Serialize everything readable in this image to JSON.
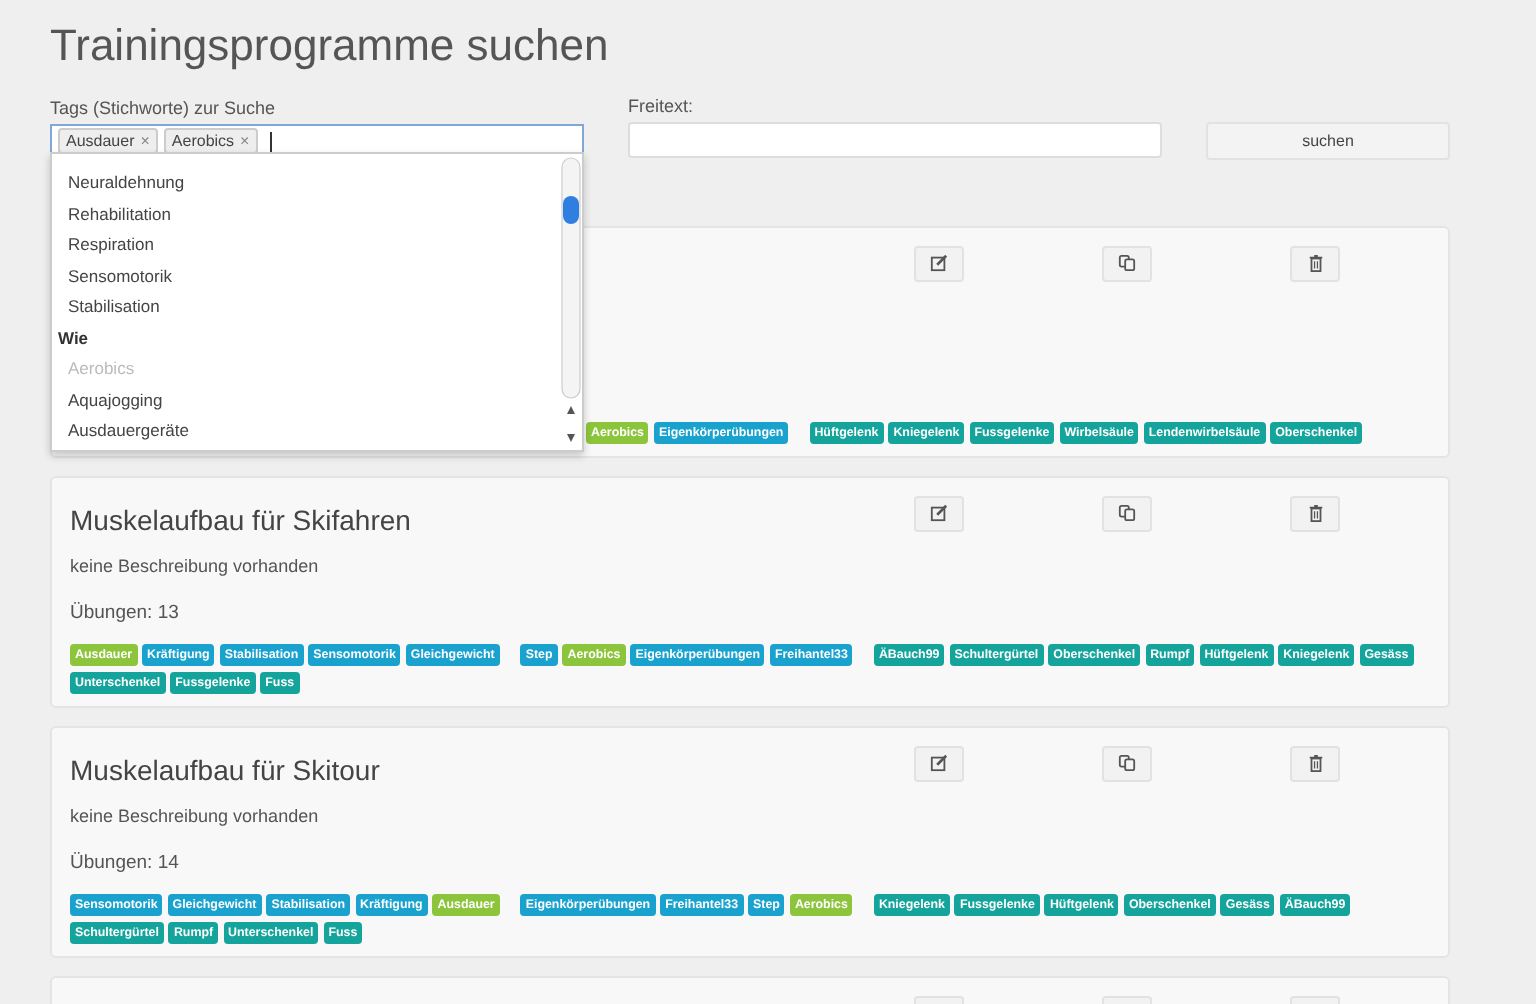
{
  "title": "Trainingsprogramme suchen",
  "search": {
    "tags_label": "Tags (Stichworte) zur Suche",
    "chips": [
      {
        "label": "Ausdauer",
        "remove": "×"
      },
      {
        "label": "Aerobics",
        "remove": "×"
      }
    ],
    "freetext_label": "Freitext:",
    "button": "suchen"
  },
  "dropdown": [
    {
      "kind": "option",
      "label": "Neuraldehnung",
      "disabled": false
    },
    {
      "kind": "option",
      "label": "Rehabilitation",
      "disabled": false
    },
    {
      "kind": "option",
      "label": "Respiration",
      "disabled": false
    },
    {
      "kind": "option",
      "label": "Sensomotorik",
      "disabled": false
    },
    {
      "kind": "option",
      "label": "Stabilisation",
      "disabled": false
    },
    {
      "kind": "group",
      "label": "Wie"
    },
    {
      "kind": "option",
      "label": "Aerobics",
      "disabled": true
    },
    {
      "kind": "option",
      "label": "Aquajogging",
      "disabled": false
    },
    {
      "kind": "option",
      "label": "Ausdauergeräte",
      "disabled": false
    }
  ],
  "cards": [
    {
      "kind": "covered",
      "tag_groups": [
        [
          {
            "label": "Aerobics",
            "color": "#8cc43c"
          },
          {
            "label": "Eigenkörperübungen",
            "color": "#1aa2cf"
          }
        ],
        [
          {
            "label": "Hüftgelenk",
            "color": "#14a49c"
          },
          {
            "label": "Kniegelenk",
            "color": "#14a49c"
          },
          {
            "label": "Fussgelenke",
            "color": "#14a49c"
          },
          {
            "label": "Wirbelsäule",
            "color": "#14a49c"
          },
          {
            "label": "Lendenwirbelsäule",
            "color": "#14a49c"
          },
          {
            "label": "Oberschenkel",
            "color": "#14a49c"
          }
        ]
      ]
    },
    {
      "kind": "full",
      "title": "Muskelaufbau für Skifahren",
      "description": "keine Beschreibung vorhanden",
      "exercises": "Übungen: 13",
      "tag_groups": [
        [
          {
            "label": "Ausdauer",
            "color": "#8cc43c"
          },
          {
            "label": "Kräftigung",
            "color": "#1aa2cf"
          },
          {
            "label": "Stabilisation",
            "color": "#1aa2cf"
          },
          {
            "label": "Sensomotorik",
            "color": "#1aa2cf"
          },
          {
            "label": "Gleichgewicht",
            "color": "#1aa2cf"
          }
        ],
        [
          {
            "label": "Step",
            "color": "#1aa2cf"
          },
          {
            "label": "Aerobics",
            "color": "#8cc43c"
          },
          {
            "label": "Eigenkörperübungen",
            "color": "#1aa2cf"
          },
          {
            "label": "Freihantel33",
            "color": "#1aa2cf"
          }
        ],
        [
          {
            "label": "ÄBauch99",
            "color": "#14a49c"
          },
          {
            "label": "Schultergürtel",
            "color": "#14a49c"
          },
          {
            "label": "Oberschenkel",
            "color": "#14a49c"
          },
          {
            "label": "Rumpf",
            "color": "#14a49c"
          },
          {
            "label": "Hüftgelenk",
            "color": "#14a49c"
          },
          {
            "label": "Kniegelenk",
            "color": "#14a49c"
          },
          {
            "label": "Gesäss",
            "color": "#14a49c"
          },
          {
            "label": "Unterschenkel",
            "color": "#14a49c"
          },
          {
            "label": "Fussgelenke",
            "color": "#14a49c"
          },
          {
            "label": "Fuss",
            "color": "#14a49c"
          }
        ]
      ]
    },
    {
      "kind": "full",
      "title": "Muskelaufbau für Skitour",
      "description": "keine Beschreibung vorhanden",
      "exercises": "Übungen: 14",
      "tag_groups": [
        [
          {
            "label": "Sensomotorik",
            "color": "#1aa2cf"
          },
          {
            "label": "Gleichgewicht",
            "color": "#1aa2cf"
          },
          {
            "label": "Stabilisation",
            "color": "#1aa2cf"
          },
          {
            "label": "Kräftigung",
            "color": "#1aa2cf"
          },
          {
            "label": "Ausdauer",
            "color": "#8cc43c"
          }
        ],
        [
          {
            "label": "Eigenkörperübungen",
            "color": "#1aa2cf"
          },
          {
            "label": "Freihantel33",
            "color": "#1aa2cf"
          },
          {
            "label": "Step",
            "color": "#1aa2cf"
          },
          {
            "label": "Aerobics",
            "color": "#8cc43c"
          }
        ],
        [
          {
            "label": "Kniegelenk",
            "color": "#14a49c"
          },
          {
            "label": "Fussgelenke",
            "color": "#14a49c"
          },
          {
            "label": "Hüftgelenk",
            "color": "#14a49c"
          },
          {
            "label": "Oberschenkel",
            "color": "#14a49c"
          },
          {
            "label": "Gesäss",
            "color": "#14a49c"
          },
          {
            "label": "ÄBauch99",
            "color": "#14a49c"
          },
          {
            "label": "Schultergürtel",
            "color": "#14a49c"
          },
          {
            "label": "Rumpf",
            "color": "#14a49c"
          },
          {
            "label": "Unterschenkel",
            "color": "#14a49c"
          },
          {
            "label": "Fuss",
            "color": "#14a49c"
          }
        ]
      ]
    },
    {
      "kind": "cut"
    }
  ]
}
